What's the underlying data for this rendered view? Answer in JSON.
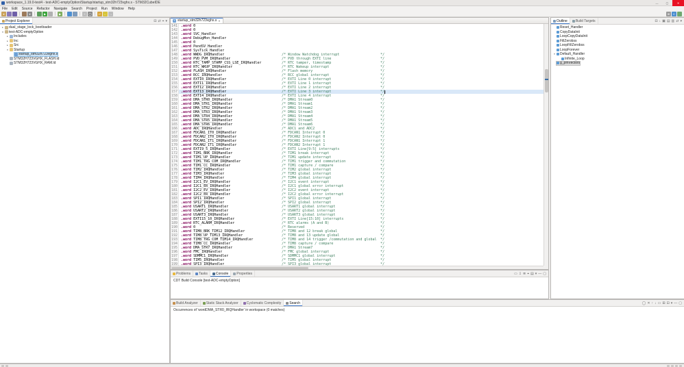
{
  "colors": {
    "accent": "#3e77c8",
    "selection": "#cbe2f5",
    "selection_border": "#8fc0e8",
    "current_line": "#d9e8f8",
    "comment": "#3f7f5f",
    "directive": "#7f0055",
    "close_button": "#e81123"
  },
  "window": {
    "title": "workspace_1.19.0-test4 - test-ADC-emptyOption/Startup/startup_stm32h723vghx.s - STM32CubeIDE",
    "minimize_glyph": "—",
    "maximize_glyph": "▢",
    "close_glyph": "✕"
  },
  "menu_bar": {
    "items": [
      "File",
      "Edit",
      "Source",
      "Refactor",
      "Navigate",
      "Search",
      "Project",
      "Run",
      "Window",
      "Help"
    ]
  },
  "toolbar": {
    "groups": [
      [
        {
          "name": "new-wizard-icon",
          "glyph": "▾",
          "color": "#caa25a"
        },
        {
          "name": "save-icon",
          "glyph": "",
          "color": "#8a7bb8"
        },
        {
          "name": "save-all-icon",
          "glyph": "",
          "color": "#6f5fa8"
        }
      ],
      [
        {
          "name": "build-icon",
          "glyph": "",
          "color": "#9c7a5a"
        },
        {
          "name": "build-all-icon",
          "glyph": "▾",
          "color": "#8c8c8c"
        }
      ],
      [
        {
          "name": "debug-icon",
          "glyph": "",
          "color": "#5a9e5a"
        },
        {
          "name": "run-icon",
          "glyph": "▶",
          "color": "#3da53d"
        },
        {
          "name": "profile-icon",
          "glyph": "",
          "color": "#b0b0b0"
        }
      ],
      [
        {
          "name": "external-tools-icon",
          "glyph": "▶",
          "color": "#7fae5f"
        }
      ],
      [
        {
          "name": "device-configuration-tool-icon",
          "glyph": "",
          "color": "#4d8fd1"
        },
        {
          "name": "sfr-view-icon",
          "glyph": "",
          "color": "#7d9bbd"
        }
      ],
      [
        {
          "name": "new-file-icon",
          "glyph": "+",
          "color": "#bdbdbd"
        },
        {
          "name": "search-icon",
          "glyph": "◯",
          "color": "#8c8c8c"
        }
      ],
      [
        {
          "name": "last-edit-location-icon",
          "glyph": "↩",
          "color": "#d7a43c"
        },
        {
          "name": "back-icon",
          "glyph": "←",
          "color": "#d7c43c"
        },
        {
          "name": "forward-icon",
          "glyph": "→",
          "color": "#bdbdbd"
        }
      ]
    ],
    "right": [
      {
        "name": "open-perspective-icon",
        "glyph": "⊞",
        "color": "#9a9a9a"
      },
      {
        "name": "cpp-perspective-icon",
        "glyph": "C",
        "color": "#4d8fd1"
      },
      {
        "name": "debug-perspective-icon",
        "glyph": "",
        "color": "#6fa86f"
      }
    ]
  },
  "icon_colors": {
    "project": "#cbb68a",
    "folder": "#e7c474",
    "includes": "#9db6d6",
    "asm-file": "#6d9fd4",
    "ld-file": "#a9b4c0"
  },
  "project_explorer": {
    "tab": "Project Explorer",
    "toolbar": [
      {
        "name": "collapse-all-icon",
        "glyph": "⊟"
      },
      {
        "name": "link-with-editor-icon",
        "glyph": "⇄"
      },
      {
        "name": "focus-icon",
        "glyph": "⌖"
      },
      {
        "name": "view-menu-icon",
        "glyph": "▾"
      }
    ],
    "items": [
      {
        "label": "dual_stage_lock_bootloader",
        "level": 0,
        "icon": "project",
        "arrow": "collapsed"
      },
      {
        "label": "test-ADC-emptyOption",
        "level": 0,
        "icon": "project",
        "arrow": "expanded"
      },
      {
        "label": "Includes",
        "level": 1,
        "icon": "includes",
        "arrow": "collapsed"
      },
      {
        "label": "Inc",
        "level": 1,
        "icon": "folder",
        "arrow": "collapsed"
      },
      {
        "label": "Src",
        "level": 1,
        "icon": "folder",
        "arrow": "collapsed"
      },
      {
        "label": "Startup",
        "level": 1,
        "icon": "folder",
        "arrow": "expanded"
      },
      {
        "label": "startup_stm32h723vghx.s",
        "level": 2,
        "icon": "asm-file",
        "arrow": "none",
        "selected": true
      },
      {
        "label": "STM32H723VGHX_FLASH.ld",
        "level": 1,
        "icon": "ld-file",
        "arrow": "none"
      },
      {
        "label": "STM32H723VGHX_RAM.ld",
        "level": 1,
        "icon": "ld-file",
        "arrow": "none"
      }
    ]
  },
  "editor": {
    "tab": {
      "label": "startup_stm32h723vghx.s",
      "file_icon_letter": "S",
      "close_glyph": "✕"
    },
    "current_line": 157,
    "lines": [
      {
        "n": 141,
        "d": ".word",
        "s": "0",
        "c": ""
      },
      {
        "n": 142,
        "d": ".word",
        "s": "0",
        "c": ""
      },
      {
        "n": 143,
        "d": ".word",
        "s": "SVC_Handler",
        "c": ""
      },
      {
        "n": 144,
        "d": ".word",
        "s": "DebugMon_Handler",
        "c": ""
      },
      {
        "n": 145,
        "d": ".word",
        "s": "0",
        "c": ""
      },
      {
        "n": 146,
        "d": ".word",
        "s": "PendSV_Handler",
        "c": ""
      },
      {
        "n": 147,
        "d": ".word",
        "s": "SysTick_Handler",
        "c": ""
      },
      {
        "n": 148,
        "d": ".word",
        "s": "WWDG_IRQHandler",
        "c": "Window Watchdog interrupt"
      },
      {
        "n": 149,
        "d": ".word",
        "s": "PVD_PVM_IRQHandler",
        "c": "PVD through EXTI line"
      },
      {
        "n": 150,
        "d": ".word",
        "s": "RTC_TAMP_STAMP_CSS_LSE_IRQHandler",
        "c": "RTC tamper, timestamp"
      },
      {
        "n": 151,
        "d": ".word",
        "s": "RTC_WKUP_IRQHandler",
        "c": "RTC Wakeup interrupt"
      },
      {
        "n": 152,
        "d": ".word",
        "s": "FLASH_IRQHandler",
        "c": "Flash memory"
      },
      {
        "n": 153,
        "d": ".word",
        "s": "RCC_IRQHandler",
        "c": "RCC global interrupt"
      },
      {
        "n": 154,
        "d": ".word",
        "s": "EXTI0_IRQHandler",
        "c": "EXTI Line 0 interrupt"
      },
      {
        "n": 155,
        "d": ".word",
        "s": "EXTI1_IRQHandler",
        "c": "EXTI Line 1 interrupt"
      },
      {
        "n": 156,
        "d": ".word",
        "s": "EXTI2_IRQHandler",
        "c": "EXTI Line 2 interrupt"
      },
      {
        "n": 157,
        "d": ".word",
        "s": "EXTI3_IRQHandler",
        "c": "EXTI Line 3 interrupt"
      },
      {
        "n": 158,
        "d": ".word",
        "s": "EXTI4_IRQHandler",
        "c": "EXTI Line 4 interrupt"
      },
      {
        "n": 159,
        "d": ".word",
        "s": "DMA_STR0_IRQHandler",
        "c": "DMA1 Stream0"
      },
      {
        "n": 160,
        "d": ".word",
        "s": "DMA_STR1_IRQHandler",
        "c": "DMA1 Stream1"
      },
      {
        "n": 161,
        "d": ".word",
        "s": "DMA_STR2_IRQHandler",
        "c": "DMA1 Stream2"
      },
      {
        "n": 162,
        "d": ".word",
        "s": "DMA_STR3_IRQHandler",
        "c": "DMA1 Stream3"
      },
      {
        "n": 163,
        "d": ".word",
        "s": "DMA_STR4_IRQHandler",
        "c": "DMA1 Stream4"
      },
      {
        "n": 164,
        "d": ".word",
        "s": "DMA_STR5_IRQHandler",
        "c": "DMA1 Stream5"
      },
      {
        "n": 165,
        "d": ".word",
        "s": "DMA_STR6_IRQHandler",
        "c": "DMA1 Stream6"
      },
      {
        "n": 166,
        "d": ".word",
        "s": "ADC_IRQHandler",
        "c": "ADC1 and ADC2"
      },
      {
        "n": 167,
        "d": ".word",
        "s": "FDCAN1_IT0_IRQHandler",
        "c": "FDCAN1 Interrupt 0"
      },
      {
        "n": 168,
        "d": ".word",
        "s": "FDCAN2_IT0_IRQHandler",
        "c": "FDCAN2 Interrupt 0"
      },
      {
        "n": 169,
        "d": ".word",
        "s": "FDCAN1_IT1_IRQHandler",
        "c": "FDCAN1 Interrupt 1"
      },
      {
        "n": 170,
        "d": ".word",
        "s": "FDCAN2_IT1_IRQHandler",
        "c": "FDCAN2 Interrupt 1"
      },
      {
        "n": 171,
        "d": ".word",
        "s": "EXTI9_5_IRQHandler",
        "c": "EXTI Line[9:5] interrupts"
      },
      {
        "n": 172,
        "d": ".word",
        "s": "TIM1_BRK_IRQHandler",
        "c": "TIM1 break interrupt"
      },
      {
        "n": 173,
        "d": ".word",
        "s": "TIM1_UP_IRQHandler",
        "c": "TIM1 update interrupt"
      },
      {
        "n": 174,
        "d": ".word",
        "s": "TIM1_TRG_COM_IRQHandler",
        "c": "TIM1 trigger and commutation"
      },
      {
        "n": 175,
        "d": ".word",
        "s": "TIM1_CC_IRQHandler",
        "c": "TIM1 capture / compare"
      },
      {
        "n": 176,
        "d": ".word",
        "s": "TIM2_IRQHandler",
        "c": "TIM2 global interrupt"
      },
      {
        "n": 177,
        "d": ".word",
        "s": "TIM3_IRQHandler",
        "c": "TIM3 global interrupt"
      },
      {
        "n": 178,
        "d": ".word",
        "s": "TIM4_IRQHandler",
        "c": "TIM4 global interrupt"
      },
      {
        "n": 179,
        "d": ".word",
        "s": "I2C1_EV_IRQHandler",
        "c": "I2C1 event interrupt"
      },
      {
        "n": 180,
        "d": ".word",
        "s": "I2C1_ER_IRQHandler",
        "c": "I2C1 global error interrupt"
      },
      {
        "n": 181,
        "d": ".word",
        "s": "I2C2_EV_IRQHandler",
        "c": "I2C2 event interrupt"
      },
      {
        "n": 182,
        "d": ".word",
        "s": "I2C2_ER_IRQHandler",
        "c": "I2C2 global error interrupt"
      },
      {
        "n": 183,
        "d": ".word",
        "s": "SPI1_IRQHandler",
        "c": "SPI1 global interrupt"
      },
      {
        "n": 184,
        "d": ".word",
        "s": "SPI2_IRQHandler",
        "c": "SPI2 global interrupt"
      },
      {
        "n": 185,
        "d": ".word",
        "s": "USART1_IRQHandler",
        "c": "USART1 global interrupt"
      },
      {
        "n": 186,
        "d": ".word",
        "s": "USART2_IRQHandler",
        "c": "USART2 global interrupt"
      },
      {
        "n": 187,
        "d": ".word",
        "s": "USART3_IRQHandler",
        "c": "USART3 global interrupt"
      },
      {
        "n": 188,
        "d": ".word",
        "s": "EXTI15_10_IRQHandler",
        "c": "EXTI Line[15:10] interrupts"
      },
      {
        "n": 189,
        "d": ".word",
        "s": "RTC_ALARM_IRQHandler",
        "c": "RTC alarms (A and B)"
      },
      {
        "n": 190,
        "d": ".word",
        "s": "0",
        "c": "Reserved"
      },
      {
        "n": 191,
        "d": ".word",
        "s": "TIM8_BRK_TIM12_IRQHandler",
        "c": "TIM8 and 12 break global"
      },
      {
        "n": 192,
        "d": ".word",
        "s": "TIM8_UP_TIM13_IRQHandler",
        "c": "TIM8 and 13 update global"
      },
      {
        "n": 193,
        "d": ".word",
        "s": "TIM8_TRG_COM_TIM14_IRQHandler",
        "c": "TIM8 and 14 trigger /commutation and global"
      },
      {
        "n": 194,
        "d": ".word",
        "s": "TIM8_CC_IRQHandler",
        "c": "TIM8 capture / compare"
      },
      {
        "n": 195,
        "d": ".word",
        "s": "DMA_STR7_IRQHandler",
        "c": "DMA1 Stream7"
      },
      {
        "n": 196,
        "d": ".word",
        "s": "FMC_IRQHandler",
        "c": "FMC global interrupt"
      },
      {
        "n": 197,
        "d": ".word",
        "s": "SDMMC1_IRQHandler",
        "c": "SDMMC1 global interrupt"
      },
      {
        "n": 198,
        "d": ".word",
        "s": "TIM5_IRQHandler",
        "c": "TIM5 global interrupt"
      },
      {
        "n": 199,
        "d": ".word",
        "s": "SPI3_IRQHandler",
        "c": "SPI3 global interrupt"
      }
    ]
  },
  "outline": {
    "tabs": [
      {
        "label": "Outline",
        "active": true,
        "icon_color": "#7f9db9"
      },
      {
        "label": "Build Targets",
        "active": false,
        "icon_color": "#8aa0a8"
      }
    ],
    "toolbar": [
      {
        "name": "collapse-all-icon",
        "glyph": "⊟"
      },
      {
        "name": "sort-icon",
        "glyph": "↓"
      },
      {
        "name": "hide-fields-icon",
        "glyph": "▣"
      },
      {
        "name": "hide-static-members-icon",
        "glyph": "▤"
      },
      {
        "name": "hide-non-public-members-icon",
        "glyph": "▥"
      },
      {
        "name": "link-with-editor-icon",
        "glyph": "⇄"
      },
      {
        "name": "view-menu-icon",
        "glyph": "▾"
      }
    ],
    "items": [
      {
        "label": "Reset_Handler",
        "level": 0
      },
      {
        "label": "CopyDataInit",
        "level": 0
      },
      {
        "label": "LoopCopyDataInit",
        "level": 0
      },
      {
        "label": "FillZerobss",
        "level": 0
      },
      {
        "label": "LoopFillZerobss",
        "level": 0
      },
      {
        "label": "LoopForever",
        "level": 0
      },
      {
        "label": "Default_Handler",
        "level": 0,
        "arrow": "expanded"
      },
      {
        "label": "Infinite_Loop",
        "level": 1
      },
      {
        "label": "g_pfnVectors",
        "level": 0,
        "selected": true
      }
    ]
  },
  "console_panel": {
    "tabs": [
      {
        "label": "Problems",
        "icon_color": "#e8b83c"
      },
      {
        "label": "Tasks",
        "icon_color": "#5d87c6"
      },
      {
        "label": "Console",
        "active": true,
        "icon_color": "#46698c"
      },
      {
        "label": "Properties",
        "icon_color": "#9aa7b0"
      }
    ],
    "toolbar": [
      {
        "name": "clear-console-icon",
        "glyph": "▭"
      },
      {
        "name": "scroll-lock-icon",
        "glyph": "⇩"
      },
      {
        "name": "word-wrap-icon",
        "glyph": "≣"
      },
      {
        "name": "pin-console-icon",
        "glyph": "⌖"
      },
      {
        "name": "display-selected-console-icon",
        "glyph": "▤"
      },
      {
        "name": "open-console-icon",
        "glyph": "▾"
      },
      {
        "name": "minimize-view-icon",
        "glyph": "—"
      },
      {
        "name": "maximize-view-icon",
        "glyph": "▢"
      }
    ],
    "content": "CDT Build Console [test-ADC-emptyOption]"
  },
  "analyzer_panel": {
    "tabs": [
      {
        "label": "Build Analyzer",
        "icon_color": "#c6904e"
      },
      {
        "label": "Static Stack Analyzer",
        "icon_color": "#7a9e53"
      },
      {
        "label": "Cyclomatic Complexity",
        "icon_color": "#8e6fae"
      },
      {
        "label": "Search",
        "active": true,
        "icon_color": "#8c8c8c"
      }
    ],
    "toolbar": [
      {
        "name": "run-search-again-icon",
        "glyph": "◯"
      },
      {
        "name": "cancel-search-icon",
        "glyph": "✕"
      },
      {
        "name": "previous-match-icon",
        "glyph": "↑"
      },
      {
        "name": "next-match-icon",
        "glyph": "↓"
      },
      {
        "name": "remove-matches-icon",
        "glyph": "▭"
      },
      {
        "name": "expand-all-icon",
        "glyph": "⊞"
      },
      {
        "name": "collapse-all-icon",
        "glyph": "⊟"
      },
      {
        "name": "search-history-icon",
        "glyph": "▾"
      },
      {
        "name": "minimize-view-icon",
        "glyph": "—"
      },
      {
        "name": "maximize-view-icon",
        "glyph": "▢"
      }
    ],
    "content": "Occurrences of 'wordDMA_STR0_IRQHandler' in workspace (0 matches)"
  },
  "status_bar": {
    "left_icons": [
      {
        "name": "editor-status-icon"
      },
      {
        "name": "smart-insert-icon"
      }
    ],
    "right_icons": [
      {
        "name": "heap-status-icon"
      },
      {
        "name": "progress-icon"
      },
      {
        "name": "background-jobs-icon"
      },
      {
        "name": "notifications-icon"
      }
    ]
  }
}
